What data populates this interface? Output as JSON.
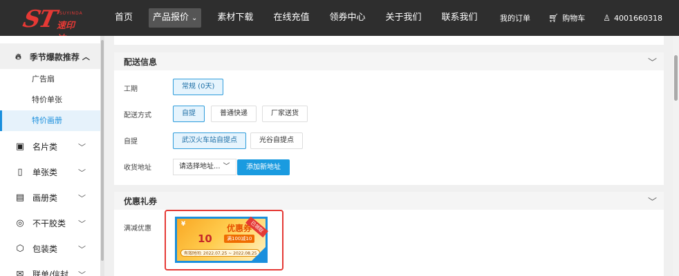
{
  "header": {
    "logo_mark": "ST",
    "logo_cn": "速印达",
    "logo_en": "SUYINDA",
    "nav": [
      {
        "label": "首页"
      },
      {
        "label": "产品报价",
        "active": true
      },
      {
        "label": "素材下载"
      },
      {
        "label": "在线充值"
      },
      {
        "label": "领券中心"
      },
      {
        "label": "关于我们"
      },
      {
        "label": "联系我们"
      }
    ],
    "my_orders": "我的订单",
    "cart": "购物车",
    "phone": "4001660318"
  },
  "sidebar": {
    "section": "季节爆款推荐",
    "sub_items": [
      {
        "label": "广告扇"
      },
      {
        "label": "特价单张"
      },
      {
        "label": "特价画册",
        "active": true
      }
    ],
    "categories": [
      {
        "label": "名片类",
        "icon": "id-card-icon"
      },
      {
        "label": "单张类",
        "icon": "clipboard-icon"
      },
      {
        "label": "画册类",
        "icon": "book-icon"
      },
      {
        "label": "不干胶类",
        "icon": "sticker-icon"
      },
      {
        "label": "包装类",
        "icon": "box-icon"
      },
      {
        "label": "联单/信封",
        "icon": "envelope-icon"
      }
    ]
  },
  "delivery": {
    "title": "配送信息",
    "period_label": "工期",
    "period_value": "常规 (0天)",
    "method_label": "配送方式",
    "methods": [
      "自提",
      "普通快递",
      "厂家送货"
    ],
    "pickup_label": "自提",
    "pickups": [
      "武汉火车站自提点",
      "光谷自提点"
    ],
    "address_label": "收货地址",
    "address_select": "请选择地址...",
    "add_address": "添加新地址"
  },
  "coupon_section": {
    "title": "优惠礼券",
    "label": "满减优惠",
    "coupon": {
      "currency": "¥",
      "amount": "10",
      "name": "优惠券",
      "condition": "满100减10",
      "validity": "有效时间: 2022.07.25 ~ 2022.08.25",
      "tag": "已领取"
    }
  },
  "colors": {
    "header_bg": "#2e2e2e",
    "brand_red": "#e53935",
    "accent_blue": "#1a9be0"
  }
}
